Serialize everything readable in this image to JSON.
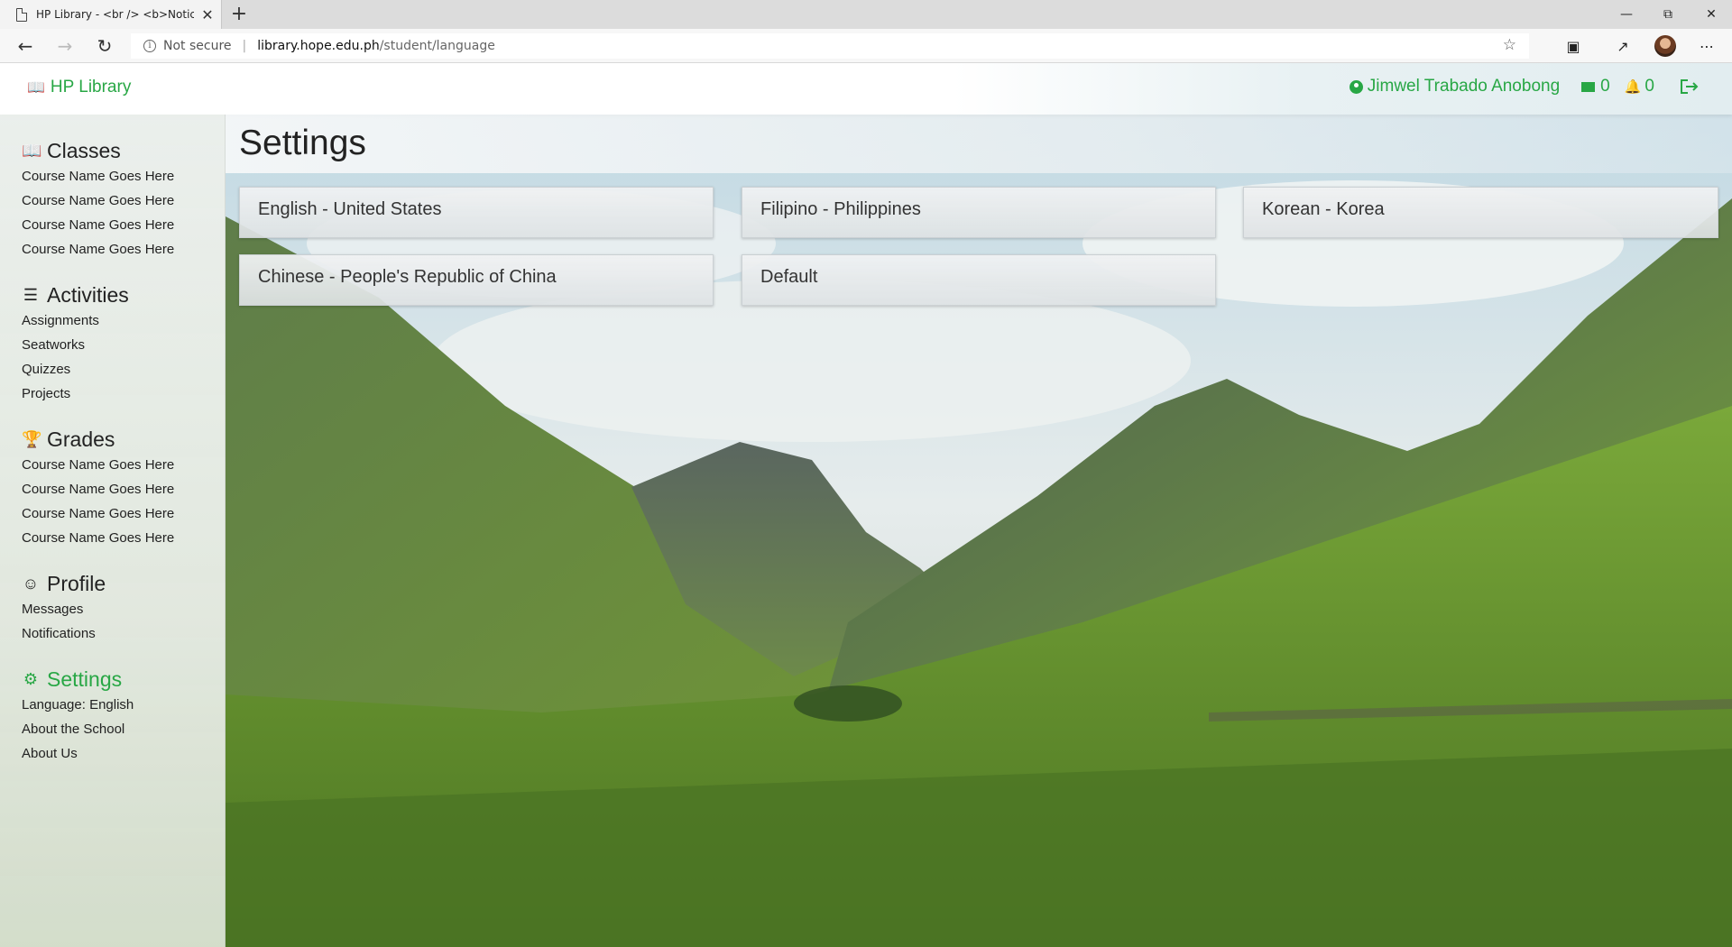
{
  "browser": {
    "tab_title": "HP Library - <br /> <b>Notice<",
    "tab_close": "✕",
    "new_tab": "+",
    "security_label": "Not secure",
    "url_host": "library.hope.edu.ph",
    "url_path": "/student/language"
  },
  "topnav": {
    "brand": "HP Library",
    "user_name": "Jimwel Trabado Anobong",
    "messages_count": "0",
    "notifications_count": "0"
  },
  "sidebar": {
    "classes": {
      "title": "Classes",
      "items": [
        "Course Name Goes Here",
        "Course Name Goes Here",
        "Course Name Goes Here",
        "Course Name Goes Here"
      ]
    },
    "activities": {
      "title": "Activities",
      "items": [
        "Assignments",
        "Seatworks",
        "Quizzes",
        "Projects"
      ]
    },
    "grades": {
      "title": "Grades",
      "items": [
        "Course Name Goes Here",
        "Course Name Goes Here",
        "Course Name Goes Here",
        "Course Name Goes Here"
      ]
    },
    "profile": {
      "title": "Profile",
      "items": [
        "Messages",
        "Notifications"
      ]
    },
    "settings": {
      "title": "Settings",
      "items": [
        "Language: English",
        "About the School",
        "About Us"
      ]
    }
  },
  "main": {
    "title": "Settings",
    "languages": [
      "English - United States",
      "Filipino - Philippines",
      "Korean - Korea",
      "Chinese - People's Republic of China",
      "Default"
    ]
  },
  "colors": {
    "accent": "#28a745"
  }
}
